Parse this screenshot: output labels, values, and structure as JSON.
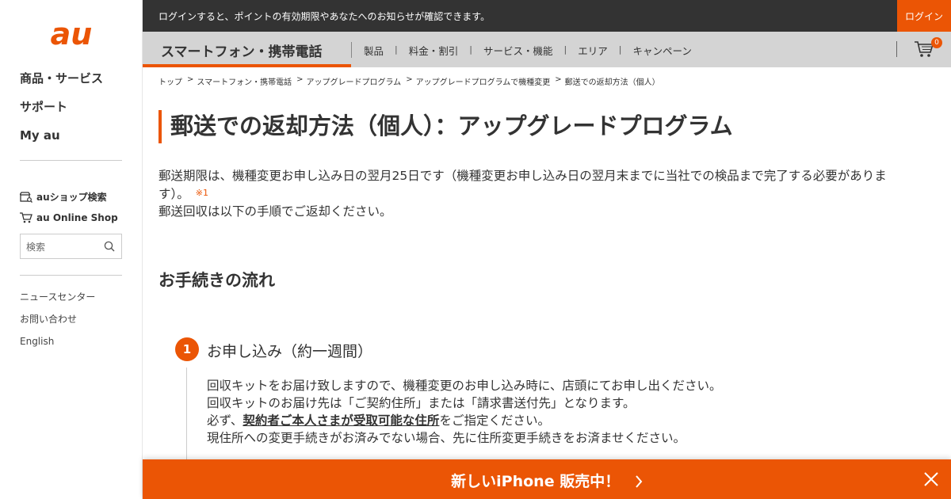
{
  "brand": {
    "logo_text": "au",
    "accent": "#eb5505"
  },
  "sidebar": {
    "main_nav": [
      "商品・サービス",
      "サポート",
      "My au"
    ],
    "shop_search": "auショップ検索",
    "online_shop": "au Online Shop",
    "search_placeholder": "検索",
    "footer_links": [
      "ニュースセンター",
      "お問い合わせ",
      "English"
    ]
  },
  "topbar": {
    "message": "ログインすると、ポイントの有効期限やあなたへのお知らせが確認できます。",
    "login": "ログイン"
  },
  "catnav": {
    "title": "スマートフォン・携帯電話",
    "items": [
      "製品",
      "料金・割引",
      "サービス・機能",
      "エリア",
      "キャンペーン"
    ],
    "cart_count": "0"
  },
  "breadcrumb": [
    "トップ",
    "スマートフォン・携帯電話",
    "アップグレードプログラム",
    "アップグレードプログラムで機種変更",
    "郵送での返却方法（個人）"
  ],
  "page": {
    "title": "郵送での返却方法（個人）：アップグレードプログラム",
    "intro_line1": "郵送期限は、機種変更お申し込み日の翌月25日です（機種変更お申し込み日の翌月末までに当社での検品まで完了する必要がありま",
    "intro_line2": "す）。",
    "intro_note": "※1",
    "intro_line3": "郵送回収は以下の手順でご返却ください。",
    "section_heading": "お手続きの流れ"
  },
  "step1": {
    "number": "1",
    "title": "お申し込み（約一週間）",
    "line1": "回収キットをお届け致しますので、機種変更のお申し込み時に、店頭にてお申し出ください。",
    "line2": "回収キットのお届け先は「ご契約住所」または「請求書送付先」となります。",
    "line3_pre": "必ず、",
    "line3_em": "契約者ご本人さまが受取可能な住所",
    "line3_post": "をご指定ください。",
    "line4": "現住所への変更手続きがお済みでない場合、先に住所変更手続きをお済ませください。"
  },
  "banner": {
    "text": "新しいiPhone 販売中！"
  }
}
